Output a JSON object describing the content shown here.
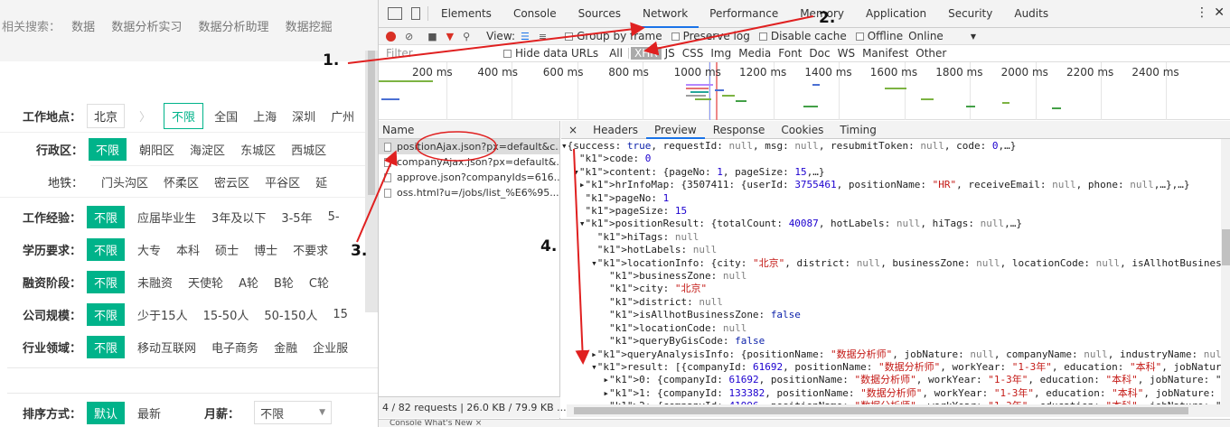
{
  "site": {
    "related": {
      "label": "相关搜索：",
      "items": [
        "数据",
        "数据分析实习",
        "数据分析助理",
        "数据挖掘"
      ]
    },
    "location": {
      "label": "工作地点：",
      "current_city": "北京",
      "all_option": "不限",
      "cities": [
        "全国",
        "上海",
        "深圳",
        "广州"
      ]
    },
    "district": {
      "label": "行政区：",
      "selected": "不限",
      "items": [
        "朝阳区",
        "海淀区",
        "东城区",
        "西城区"
      ]
    },
    "subway": {
      "label": "地铁：",
      "items": [
        "门头沟区",
        "怀柔区",
        "密云区",
        "平谷区",
        "延"
      ]
    },
    "experience": {
      "label": "工作经验：",
      "selected": "不限",
      "items": [
        "应届毕业生",
        "3年及以下",
        "3-5年",
        "5-"
      ]
    },
    "education": {
      "label": "学历要求：",
      "selected": "不限",
      "items": [
        "大专",
        "本科",
        "硕士",
        "博士",
        "不要求"
      ]
    },
    "financing": {
      "label": "融资阶段：",
      "selected": "不限",
      "items": [
        "未融资",
        "天使轮",
        "A轮",
        "B轮",
        "C轮"
      ]
    },
    "company_size": {
      "label": "公司规模：",
      "selected": "不限",
      "items": [
        "少于15人",
        "15-50人",
        "50-150人",
        "15"
      ]
    },
    "industry": {
      "label": "行业领域：",
      "selected": "不限",
      "items": [
        "移动互联网",
        "电子商务",
        "金融",
        "企业服"
      ]
    },
    "sort": {
      "label": "排序方式：",
      "selected": "默认",
      "other": "最新",
      "salary_label": "月薪：",
      "salary_value": "不限"
    }
  },
  "devtools": {
    "tabs": [
      "Elements",
      "Console",
      "Sources",
      "Network",
      "Performance",
      "Memory",
      "Application",
      "Security",
      "Audits"
    ],
    "active_tab": "Network",
    "toolbar": {
      "view_label": "View:",
      "group_by_frame": "Group by frame",
      "preserve_log": "Preserve log",
      "disable_cache": "Disable cache",
      "offline": "Offline",
      "throttle": "Online"
    },
    "filter": {
      "placeholder": "Filter",
      "hide_data_urls": "Hide data URLs",
      "types": [
        "All",
        "XHR",
        "JS",
        "CSS",
        "Img",
        "Media",
        "Font",
        "Doc",
        "WS",
        "Manifest",
        "Other"
      ],
      "active_type": "XHR"
    },
    "timeline_ticks": [
      "200 ms",
      "400 ms",
      "600 ms",
      "800 ms",
      "1000 ms",
      "1200 ms",
      "1400 ms",
      "1600 ms",
      "1800 ms",
      "2000 ms",
      "2200 ms",
      "2400 ms"
    ],
    "requests": {
      "header": "Name",
      "rows": [
        "positionAjax.json?px=default&c...",
        "companyAjax.json?px=default&...",
        "approve.json?companyIds=616...",
        "oss.html?u=/jobs/list_%E6%95..."
      ],
      "status": "4 / 82 requests  |  26.0 KB / 79.9 KB ..."
    },
    "preview_tabs": [
      "×",
      "Headers",
      "Preview",
      "Response",
      "Cookies",
      "Timing"
    ],
    "active_preview_tab": "Preview",
    "json_lines": [
      "▾{success: true, requestId: null, msg: null, resubmitToken: null, code: 0,…}",
      "   code: 0",
      "  ▾content: {pageNo: 1, pageSize: 15,…}",
      "   ▸hrInfoMap: {3507411: {userId: 3755461, positionName: \"HR\", receiveEmail: null, phone: null,…},…}",
      "    pageNo: 1",
      "    pageSize: 15",
      "   ▾positionResult: {totalCount: 40087, hotLabels: null, hiTags: null,…}",
      "      hiTags: null",
      "      hotLabels: null",
      "     ▾locationInfo: {city: \"北京\", district: null, businessZone: null, locationCode: null, isAllhotBusinessZone",
      "        businessZone: null",
      "        city: \"北京\"",
      "        district: null",
      "        isAllhotBusinessZone: false",
      "        locationCode: null",
      "        queryByGisCode: false",
      "     ▸queryAnalysisInfo: {positionName: \"数据分析师\", jobNature: null, companyName: null, industryName: null, u",
      "     ▾result: [{companyId: 61692, positionName: \"数据分析师\", workYear: \"1-3年\", education: \"本科\", jobNature: ",
      "       ▸0: {companyId: 61692, positionName: \"数据分析师\", workYear: \"1-3年\", education: \"本科\", jobNature: \"全职",
      "       ▸1: {companyId: 133382, positionName: \"数据分析师\", workYear: \"1-3年\", education: \"本科\", jobNature: \"全职",
      "       ▸2: {companyId: 41996, positionName: \"数据分析师\", workYear: \"1-3年\", education: \"本科\", jobNature: \"全职"
    ],
    "drawer_text": "Console   What's New ×"
  },
  "annotations": [
    "1.",
    "2.",
    "3.",
    "4."
  ],
  "colors": {
    "brand_green": "#00b38a",
    "annotation_red": "#e02020",
    "devtools_blue": "#1a73e8"
  }
}
